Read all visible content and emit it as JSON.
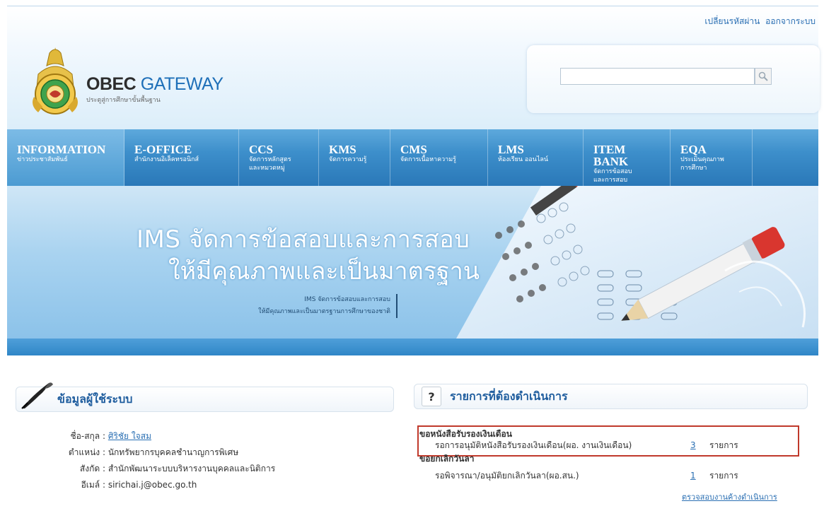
{
  "header": {
    "top_links": [
      "เปลี่ยนรหัสผ่าน",
      "ออกจากระบบ"
    ],
    "logo": {
      "title_bold": "OBEC",
      "title_rest": "GATEWAY",
      "subtitle": "ประตูสู่การศึกษาขั้นพื้นฐาน"
    },
    "search": {
      "value": "",
      "placeholder": ""
    }
  },
  "nav": [
    {
      "title": "INFORMATION",
      "sub": [
        "ข่าวประชาสัมพันธ์"
      ]
    },
    {
      "title": "E-OFFICE",
      "sub": [
        "สำนักงานอิเล็คทรอนิกส์"
      ]
    },
    {
      "title": "CCS",
      "sub": [
        "จัดการหลักสูตร",
        "และหมวดหมู่"
      ]
    },
    {
      "title": "KMS",
      "sub": [
        "จัดการความรู้"
      ]
    },
    {
      "title": "CMS",
      "sub": [
        "จัดการเนื้อหาความรู้"
      ]
    },
    {
      "title": "LMS",
      "sub": [
        "ห้องเรียน ออนไลน์"
      ]
    },
    {
      "title": "ITEM BANK",
      "sub": [
        "จัดการข้อสอบ",
        "และการสอบ"
      ]
    },
    {
      "title": "EQA",
      "sub": [
        "ประเมินคุณภาพ",
        "การศึกษา"
      ]
    }
  ],
  "banner": {
    "line1": "IMS จัดการข้อสอบและการสอบ",
    "line2": "ให้มีคุณภาพและเป็นมาตรฐาน",
    "small1": "IMS จัดการข้อสอบและการสอบ",
    "small2": "ให้มีคุณภาพและเป็นมาตรฐานการศึกษาของชาติ"
  },
  "user_panel": {
    "title": "ข้อมูลผู้ใช้ระบบ",
    "rows": [
      {
        "label": "ชื่อ-สกุล :",
        "value": "ศิริชัย ใจสม",
        "link": true
      },
      {
        "label": "ตำแหน่ง :",
        "value": "นักทรัพยากรบุคคลชำนาญการพิเศษ"
      },
      {
        "label": "สังกัด :",
        "value": "สำนักพัฒนาระบบบริหารงานบุคคลและนิติการ"
      },
      {
        "label": "อีเมล์ :",
        "value": "sirichai.j@obec.go.th"
      }
    ]
  },
  "tasks_panel": {
    "title": "รายการที่ต้องดำเนินการ",
    "help_symbol": "?",
    "groups": [
      {
        "title": "ขอหนังสือรับรองเงินเดือน",
        "desc": "รอการอนุมัติหนังสือรับรองเงินเดือน(ผอ. งานเงินเดือน)",
        "count": "3",
        "unit": "รายการ"
      },
      {
        "title": "ขอยกเลิกวันลา",
        "desc": "รอพิจารณา/อนุมัติยกเลิกวันลา(ผอ.สน.)",
        "count": "1",
        "unit": "รายการ"
      }
    ],
    "check_link": "ตรวจสอบงานค้างดำเนินการ"
  },
  "colors": {
    "nav_blue": "#3d8fcb",
    "link": "#2a6fb3",
    "highlight": "#c0392b",
    "title_blue": "#1f5d9e"
  }
}
